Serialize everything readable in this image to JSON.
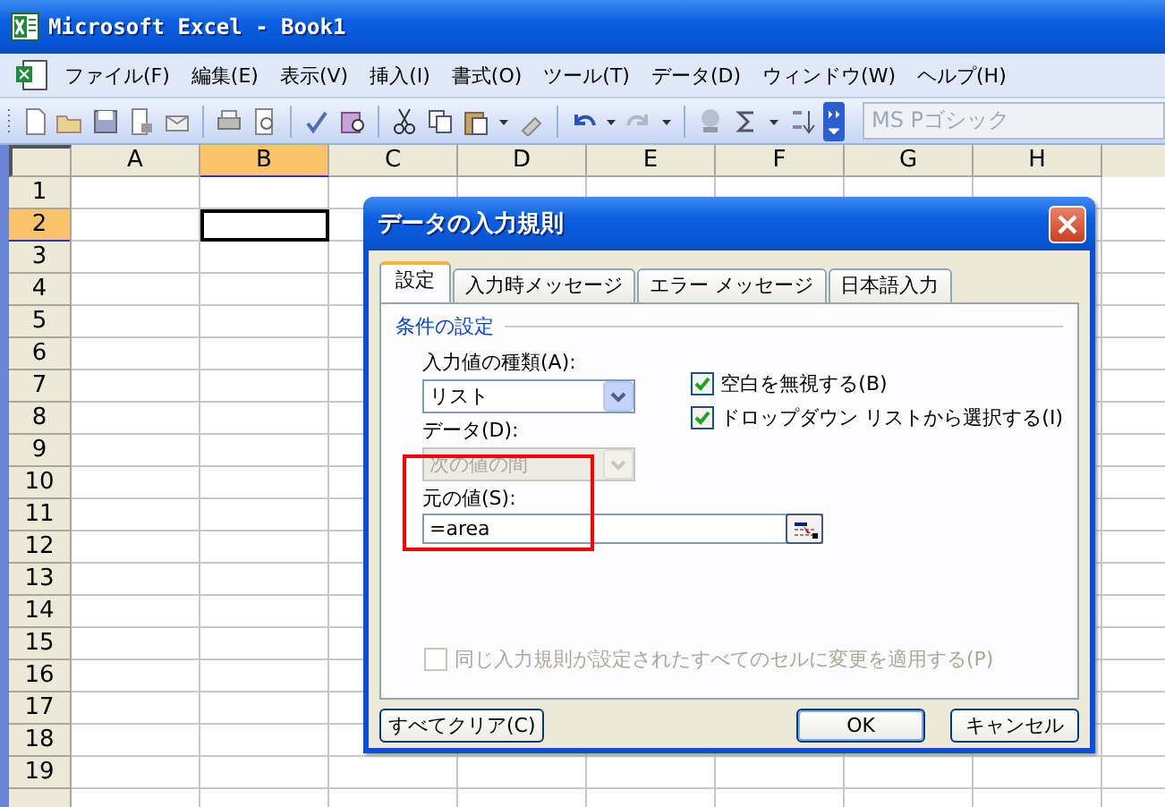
{
  "window": {
    "title": "Microsoft Excel - Book1"
  },
  "menu": [
    {
      "label": "ファイル(F)"
    },
    {
      "label": "編集(E)"
    },
    {
      "label": "表示(V)"
    },
    {
      "label": "挿入(I)"
    },
    {
      "label": "書式(O)"
    },
    {
      "label": "ツール(T)"
    },
    {
      "label": "データ(D)"
    },
    {
      "label": "ウィンドウ(W)"
    },
    {
      "label": "ヘルプ(H)"
    }
  ],
  "toolbar": {
    "font_box": {
      "value": "MS Pゴシック",
      "disabled": true
    }
  },
  "sheet": {
    "columns": [
      {
        "label": "A",
        "selected": false
      },
      {
        "label": "B",
        "selected": true
      },
      {
        "label": "C",
        "selected": false
      },
      {
        "label": "D",
        "selected": false
      },
      {
        "label": "E",
        "selected": false
      },
      {
        "label": "F",
        "selected": false
      },
      {
        "label": "G",
        "selected": false
      },
      {
        "label": "H",
        "selected": false
      }
    ],
    "rows": [
      {
        "label": "1",
        "selected": false
      },
      {
        "label": "2",
        "selected": true
      },
      {
        "label": "3",
        "selected": false
      },
      {
        "label": "4",
        "selected": false
      },
      {
        "label": "5",
        "selected": false
      },
      {
        "label": "6",
        "selected": false
      },
      {
        "label": "7",
        "selected": false
      },
      {
        "label": "8",
        "selected": false
      },
      {
        "label": "9",
        "selected": false
      },
      {
        "label": "10",
        "selected": false
      },
      {
        "label": "11",
        "selected": false
      },
      {
        "label": "12",
        "selected": false
      },
      {
        "label": "13",
        "selected": false
      },
      {
        "label": "14",
        "selected": false
      },
      {
        "label": "15",
        "selected": false
      },
      {
        "label": "16",
        "selected": false
      },
      {
        "label": "17",
        "selected": false
      },
      {
        "label": "18",
        "selected": false
      },
      {
        "label": "19",
        "selected": false
      }
    ]
  },
  "dialog": {
    "title": "データの入力規則",
    "tabs": [
      {
        "label": "設定",
        "selected": true
      },
      {
        "label": "入力時メッセージ",
        "selected": false
      },
      {
        "label": "エラー メッセージ",
        "selected": false
      },
      {
        "label": "日本語入力",
        "selected": false
      }
    ],
    "group": "条件の設定",
    "type_label": "入力値の種類(A):",
    "type_value": "リスト",
    "data_label": "データ(D):",
    "data_value": "次の値の間",
    "data_disabled": true,
    "source_label": "元の値(S):",
    "source_value": "=area",
    "options": [
      {
        "label": "空白を無視する(B)",
        "checked": true
      },
      {
        "label": "ドロップダウン リストから選択する(I)",
        "checked": true
      }
    ],
    "apply_all": {
      "label": "同じ入力規則が設定されたすべてのセルに変更を適用する(P)",
      "checked": false,
      "disabled": true
    },
    "buttons": [
      {
        "label": "すべてクリア(C)",
        "default": false
      },
      {
        "label": "OK",
        "default": true
      },
      {
        "label": "キャンセル",
        "default": false
      }
    ]
  }
}
